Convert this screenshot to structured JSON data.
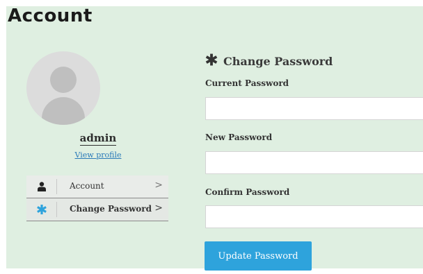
{
  "page": {
    "title": "Account"
  },
  "profile": {
    "username": "admin",
    "view_profile_label": "View profile"
  },
  "menu": {
    "items": [
      {
        "label": "Account",
        "icon": "user-icon",
        "chevron": ">"
      },
      {
        "label": "Change Password",
        "icon": "asterisk-icon",
        "chevron": ">"
      }
    ]
  },
  "form": {
    "title": "Change Password",
    "title_icon": "asterisk-icon",
    "current_password_label": "Current Password",
    "current_password_value": "",
    "new_password_label": "New Password",
    "new_password_value": "",
    "confirm_password_label": "Confirm Password",
    "confirm_password_value": "",
    "submit_label": "Update Password"
  },
  "colors": {
    "panel_bg": "#dfefe1",
    "accent": "#2ea3dc",
    "link": "#2a7ab8"
  }
}
